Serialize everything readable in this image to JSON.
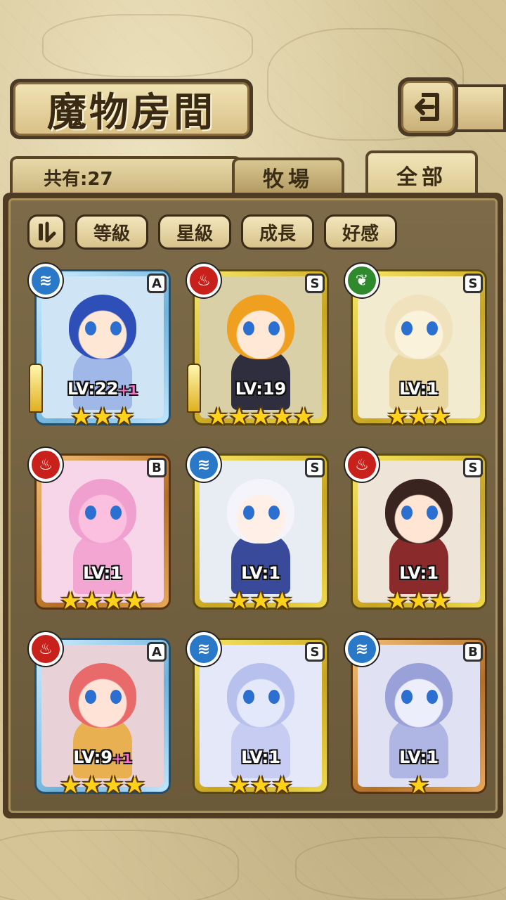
{
  "header": {
    "title": "魔物房間",
    "back_icon": "back-arrow-icon"
  },
  "tabs": {
    "count_label": "共有:27",
    "items": [
      {
        "label": "牧場",
        "active": false
      },
      {
        "label": "全部",
        "active": true
      }
    ]
  },
  "filters": {
    "toggle_icon": "sort-toggle-icon",
    "items": [
      "等級",
      "星級",
      "成長",
      "好感"
    ]
  },
  "monsters": [
    {
      "element": "water",
      "rank": "A",
      "level": "LV:22",
      "bonus": "+1",
      "stars": 3,
      "frame": "blue",
      "weapon": true,
      "hair": "#2e4fb8",
      "skin": "#ffe7d6",
      "bodycol": "#9fb8e8",
      "bg": "#cfe4f4"
    },
    {
      "element": "fire",
      "rank": "S",
      "level": "LV:19",
      "bonus": "",
      "stars": 5,
      "frame": "gold",
      "weapon": true,
      "hair": "#f0a020",
      "skin": "#ffe9d6",
      "bodycol": "#2e2e3e",
      "bg": "#d9d0a8"
    },
    {
      "element": "wood",
      "rank": "S",
      "level": "LV:1",
      "bonus": "",
      "stars": 3,
      "frame": "gold",
      "weapon": false,
      "hair": "#efe2bd",
      "skin": "#fbf2dc",
      "bodycol": "#e8d69e",
      "bg": "#f2ebcf"
    },
    {
      "element": "fire",
      "rank": "B",
      "level": "LV:1",
      "bonus": "",
      "stars": 4,
      "frame": "bronze",
      "weapon": false,
      "hair": "#f0a0cf",
      "skin": "#fbc0e0",
      "bodycol": "#f3a6d2",
      "bg": "#f7d6ea"
    },
    {
      "element": "water",
      "rank": "S",
      "level": "LV:1",
      "bonus": "",
      "stars": 3,
      "frame": "gold",
      "weapon": false,
      "hair": "#f4f4fa",
      "skin": "#ffefe6",
      "bodycol": "#3a4a9a",
      "bg": "#e8edf4"
    },
    {
      "element": "fire",
      "rank": "S",
      "level": "LV:1",
      "bonus": "",
      "stars": 3,
      "frame": "gold",
      "weapon": false,
      "hair": "#3a2420",
      "skin": "#ffe6d4",
      "bodycol": "#8a2a2a",
      "bg": "#efe4d8"
    },
    {
      "element": "fire",
      "rank": "A",
      "level": "LV:9",
      "bonus": "+1",
      "stars": 4,
      "frame": "blue",
      "weapon": false,
      "hair": "#e86a6a",
      "skin": "#ffe3d6",
      "bodycol": "#e8b050",
      "bg": "#e8d2d8"
    },
    {
      "element": "water",
      "rank": "S",
      "level": "LV:1",
      "bonus": "",
      "stars": 3,
      "frame": "gold",
      "weapon": false,
      "hair": "#b8c0ee",
      "skin": "#e4e8fb",
      "bodycol": "#c6ccf2",
      "bg": "#e4e8f8"
    },
    {
      "element": "water",
      "rank": "B",
      "level": "LV:1",
      "bonus": "",
      "stars": 1,
      "frame": "bronze",
      "weapon": false,
      "hair": "#9aa0d8",
      "skin": "#eceefb",
      "bodycol": "#b0b6e4",
      "bg": "#e0e2f4"
    }
  ],
  "colors": {
    "gold_star": "#ffd21a",
    "water": "#2a78c8",
    "fire": "#c8201a",
    "wood": "#2e8a2c"
  }
}
